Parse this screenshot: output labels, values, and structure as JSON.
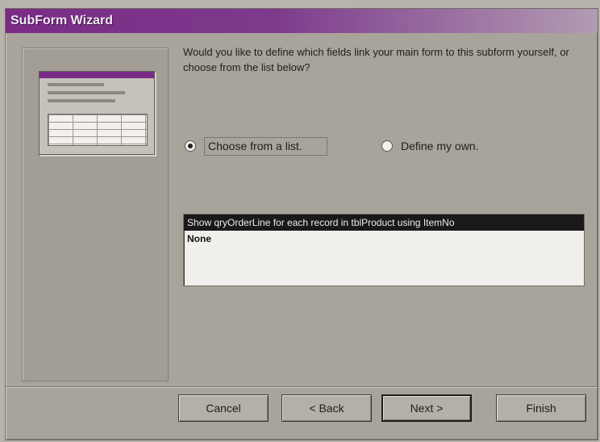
{
  "window": {
    "title": "SubForm Wizard"
  },
  "question": "Would you like to define which fields link your main form to this subform yourself, or choose from the list below?",
  "options": {
    "choose_label": "Choose from a list.",
    "choose_selected": true,
    "define_label": "Define my own.",
    "define_selected": false
  },
  "list": {
    "items": [
      "Show qryOrderLine for each record in tblProduct using ItemNo",
      "None"
    ]
  },
  "buttons": {
    "cancel": "Cancel",
    "back": "< Back",
    "next": "Next >",
    "finish": "Finish"
  },
  "colors": {
    "titlebar_start": "#7a2b86",
    "titlebar_end": "#b29bb2",
    "dialog_bg": "#a9a49b",
    "list_selection": "#1a1818"
  }
}
